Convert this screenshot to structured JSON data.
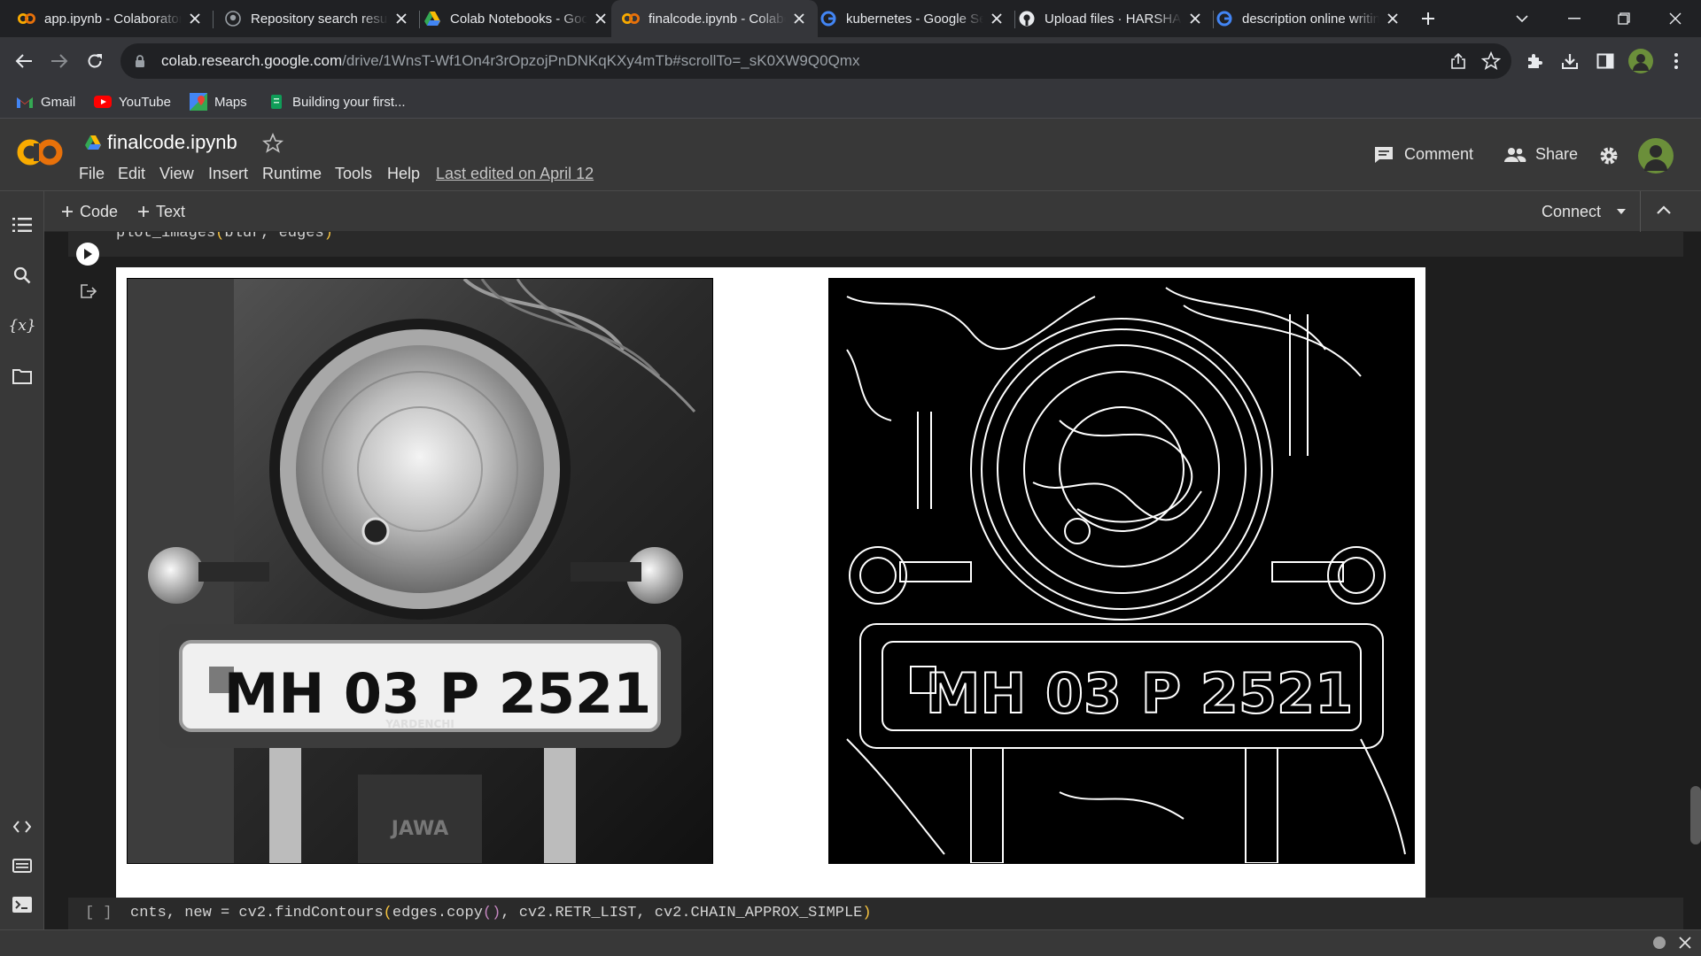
{
  "browser": {
    "tabs": [
      {
        "title": "app.ipynb - Colaboratory",
        "favicon": "colab-icon",
        "active": false
      },
      {
        "title": "Repository search results",
        "favicon": "github-icon",
        "active": false
      },
      {
        "title": "Colab Notebooks - Google Drive",
        "favicon": "google-drive-icon",
        "active": false
      },
      {
        "title": "finalcode.ipynb - Colaboratory",
        "favicon": "colab-icon",
        "active": true
      },
      {
        "title": "kubernetes - Google Search",
        "favicon": "google-icon",
        "active": false
      },
      {
        "title": "Upload files · HARSHA",
        "favicon": "github-icon",
        "active": false
      },
      {
        "title": "description online writing",
        "favicon": "google-icon",
        "active": false
      }
    ],
    "address": {
      "host": "colab.research.google.com",
      "path": "/drive/1WnsT-Wf1On4r3rOpzojPnDNKqKXy4mTb#scrollTo=_sK0XW9Q0Qmx"
    },
    "bookmarks": [
      {
        "label": "Gmail",
        "icon": "gmail-icon"
      },
      {
        "label": "YouTube",
        "icon": "youtube-icon"
      },
      {
        "label": "Maps",
        "icon": "maps-icon"
      },
      {
        "label": "Building your first...",
        "icon": "bookmark-page-icon"
      }
    ]
  },
  "colab": {
    "logo": "CO",
    "notebook_title": "finalcode.ipynb",
    "menu": [
      "File",
      "Edit",
      "View",
      "Insert",
      "Runtime",
      "Tools",
      "Help"
    ],
    "last_edited": "Last edited on April 12",
    "comment_label": "Comment",
    "share_label": "Share",
    "add_code_label": "Code",
    "add_text_label": "Text",
    "connect_label": "Connect"
  },
  "cells": {
    "prev_code": {
      "fn": "plot_images",
      "open": "(",
      "args": "blur, edges",
      "close": ")"
    },
    "output_images": [
      {
        "kind": "grayscale photo",
        "plate": "MH 03 P 2521",
        "sub": "YARDENCHI",
        "badge": "JAWA"
      },
      {
        "kind": "edge map",
        "plate": "MH 03 P 2521"
      }
    ],
    "next_code": {
      "bracket": "[ ]",
      "lhs": "cnts, new = cv2.findContours",
      "p1": "(",
      "a1": "edges.copy",
      "p2": "()",
      "a2": ", cv2.RETR_LIST, cv2.CHAIN_APPROX_SIMPLE",
      "p3": ")"
    }
  },
  "colors": {
    "colab_orange": "#f9ab00",
    "accent_blue": "#8ab4f8"
  }
}
